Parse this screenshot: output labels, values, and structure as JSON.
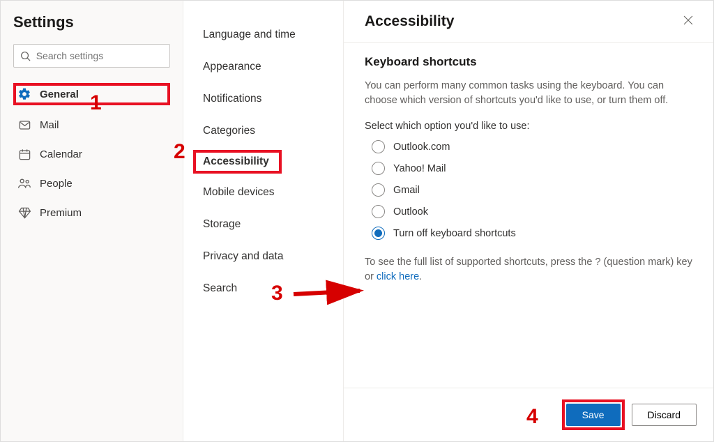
{
  "title": "Settings",
  "search": {
    "placeholder": "Search settings"
  },
  "nav": [
    {
      "label": "General",
      "active": true
    },
    {
      "label": "Mail"
    },
    {
      "label": "Calendar"
    },
    {
      "label": "People"
    },
    {
      "label": "Premium"
    }
  ],
  "subnav": [
    {
      "label": "Language and time"
    },
    {
      "label": "Appearance"
    },
    {
      "label": "Notifications"
    },
    {
      "label": "Categories"
    },
    {
      "label": "Accessibility",
      "selected": true
    },
    {
      "label": "Mobile devices"
    },
    {
      "label": "Storage"
    },
    {
      "label": "Privacy and data"
    },
    {
      "label": "Search"
    }
  ],
  "panel": {
    "title": "Accessibility",
    "section_heading": "Keyboard shortcuts",
    "intro": "You can perform many common tasks using the keyboard. You can choose which version of shortcuts you'd like to use, or turn them off.",
    "select_prompt": "Select which option you'd like to use:",
    "options": [
      {
        "label": "Outlook.com"
      },
      {
        "label": "Yahoo! Mail"
      },
      {
        "label": "Gmail"
      },
      {
        "label": "Outlook"
      },
      {
        "label": "Turn off keyboard shortcuts",
        "selected": true
      }
    ],
    "help_prefix": "To see the full list of supported shortcuts, press the ? (question mark) key or ",
    "help_link": "click here",
    "help_suffix": "."
  },
  "footer": {
    "save": "Save",
    "discard": "Discard"
  },
  "annotations": {
    "n1": "1",
    "n2": "2",
    "n3": "3",
    "n4": "4"
  }
}
